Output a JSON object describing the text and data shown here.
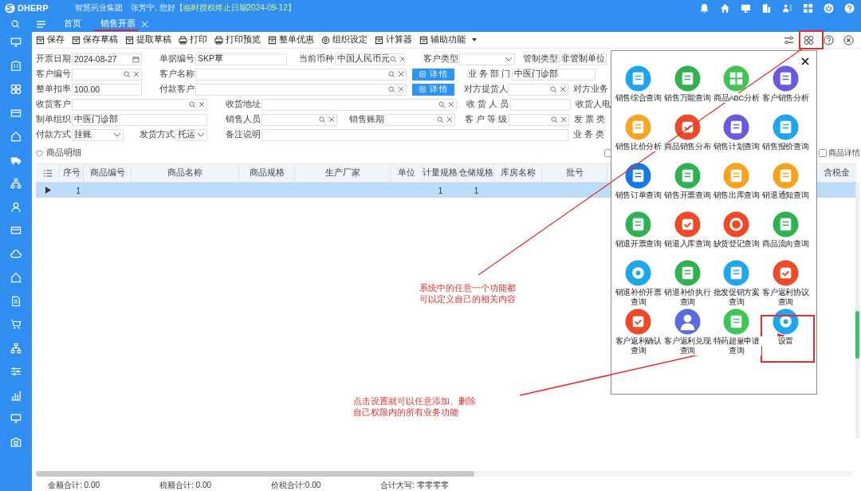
{
  "header": {
    "logo": "DHERP",
    "company": "智慧药业集团",
    "greeting": "张芳宁, 您好",
    "license_notice": "【临时授权终止日期2024-09-12】"
  },
  "tabs": [
    {
      "label": "首页",
      "selected": false,
      "closable": false
    },
    {
      "label": "销售开票",
      "selected": true,
      "closable": true
    }
  ],
  "toolbar": {
    "buttons": [
      "保存",
      "保存草稿",
      "提取草稿",
      "打印",
      "打印预览",
      "整单优惠",
      "组织设定",
      "计算器",
      "辅助功能"
    ]
  },
  "form": {
    "rows": [
      {
        "fields": [
          {
            "kind": "date",
            "label": "开票日期",
            "value": "2024-08-27"
          },
          {
            "kind": "text",
            "label": "单据编号",
            "value": "SKP草"
          },
          {
            "kind": "search",
            "label": "当前币种",
            "value": "中国人民币元"
          },
          {
            "kind": "select",
            "label": "客户类型"
          },
          {
            "kind": "text",
            "label": "管制类型",
            "value": "非管制单位"
          }
        ]
      },
      {
        "fields": [
          {
            "kind": "search",
            "label": "客户编号"
          },
          {
            "kind": "search",
            "label": "客户名称"
          },
          {
            "kind": "button",
            "label": "详 情"
          },
          {
            "kind": "text",
            "label": "业 务 部 门",
            "value": "中医门诊部"
          }
        ]
      },
      {
        "fields": [
          {
            "kind": "text",
            "label": "整单扣率",
            "value": "100.00"
          },
          {
            "kind": "search",
            "label": "付款客户"
          },
          {
            "kind": "button",
            "label": "详 情"
          },
          {
            "kind": "search",
            "label": "对方提货人"
          },
          {
            "kind": "label",
            "label": "对方业务"
          }
        ]
      },
      {
        "fields": [
          {
            "kind": "search",
            "label": "收货客户"
          },
          {
            "kind": "search",
            "label": "收货地址"
          },
          {
            "kind": "text",
            "label": "收 货 人 员"
          },
          {
            "kind": "label",
            "label": "收货人电"
          }
        ]
      },
      {
        "fields": [
          {
            "kind": "text",
            "label": "制单组织",
            "value": "中医门诊部"
          },
          {
            "kind": "search",
            "label": "销售人员"
          },
          {
            "kind": "search",
            "label": "销售账期"
          },
          {
            "kind": "search",
            "label": "客 户 等 级"
          },
          {
            "kind": "label",
            "label": "发 票 类"
          }
        ]
      },
      {
        "fields": [
          {
            "kind": "select",
            "label": "付款方式",
            "value": "挂账"
          },
          {
            "kind": "select",
            "label": "发货方式",
            "value": "托运"
          },
          {
            "kind": "text",
            "label": "备注说明"
          },
          {
            "kind": "label",
            "label": "业 务 类"
          }
        ]
      }
    ]
  },
  "details": {
    "title": "商品明细",
    "options": [
      {
        "checked": false
      },
      {
        "label": "商品详情",
        "checked": false
      }
    ]
  },
  "table": {
    "columns": [
      "序号",
      "商品编号",
      "商品名称",
      "商品规格",
      "生产厂家",
      "单位",
      "计量规格",
      "仓储规格",
      "库房名称",
      "批号",
      "含税金"
    ],
    "rows": [
      {
        "selected": true,
        "cells": [
          "1",
          null,
          null,
          null,
          null,
          null,
          "1",
          "1",
          null,
          null,
          null
        ]
      }
    ]
  },
  "function_panel": {
    "items": [
      {
        "label": "销售综合查询",
        "color": "#1ea5f0"
      },
      {
        "label": "销售万能查询",
        "color": "#2eb24f"
      },
      {
        "label": "商品ABC分析",
        "color": "#3fc456"
      },
      {
        "label": "客户销售分析",
        "color": "#6a5ae0"
      },
      {
        "label": "销售比价分析",
        "color": "#f6a623"
      },
      {
        "label": "商品销售分布",
        "color": "#ee4a2a"
      },
      {
        "label": "销售计划查询",
        "color": "#6a5ae0"
      },
      {
        "label": "销售报价查询",
        "color": "#1ea5f0"
      },
      {
        "label": "销售订单查询",
        "color": "#1677e8"
      },
      {
        "label": "销售开票查询",
        "color": "#2eb24f"
      },
      {
        "label": "销售出库查询",
        "color": "#f7a21b"
      },
      {
        "label": "销退通知查询",
        "color": "#f7a21b"
      },
      {
        "label": "销退开票查询",
        "color": "#2eb24f"
      },
      {
        "label": "销退入库查询",
        "color": "#ee4a2a"
      },
      {
        "label": "缺货登记查询",
        "color": "#ee4a2a"
      },
      {
        "label": "商品流向查询",
        "color": "#2eb24f"
      },
      {
        "label": "销退补价开票查询",
        "color": "#1ea5f0"
      },
      {
        "label": "销退补价执行查询",
        "color": "#2eb24f"
      },
      {
        "label": "批发促销方案查询",
        "color": "#1ea5f0"
      },
      {
        "label": "客户返利协议查询",
        "color": "#ee4a2a"
      },
      {
        "label": "客户返利确认查询",
        "color": "#ee4a2a"
      },
      {
        "label": "客户返利兑现查询",
        "color": "#5a6ae0"
      },
      {
        "label": "特药超量申请查询",
        "color": "#3fc456"
      },
      {
        "label": "设置",
        "color": "#1ea5f0"
      }
    ]
  },
  "annotations": [
    "系统中的任意一个功能都可以定义自己的相关内容",
    "点击设置就可以任意添加、删除自己权限内的所有业务功能"
  ],
  "status_bar": [
    "金额合计: 0.00",
    "税额合计: 0.00",
    "价税合计:0.00",
    "合计大写: 零零零零"
  ]
}
